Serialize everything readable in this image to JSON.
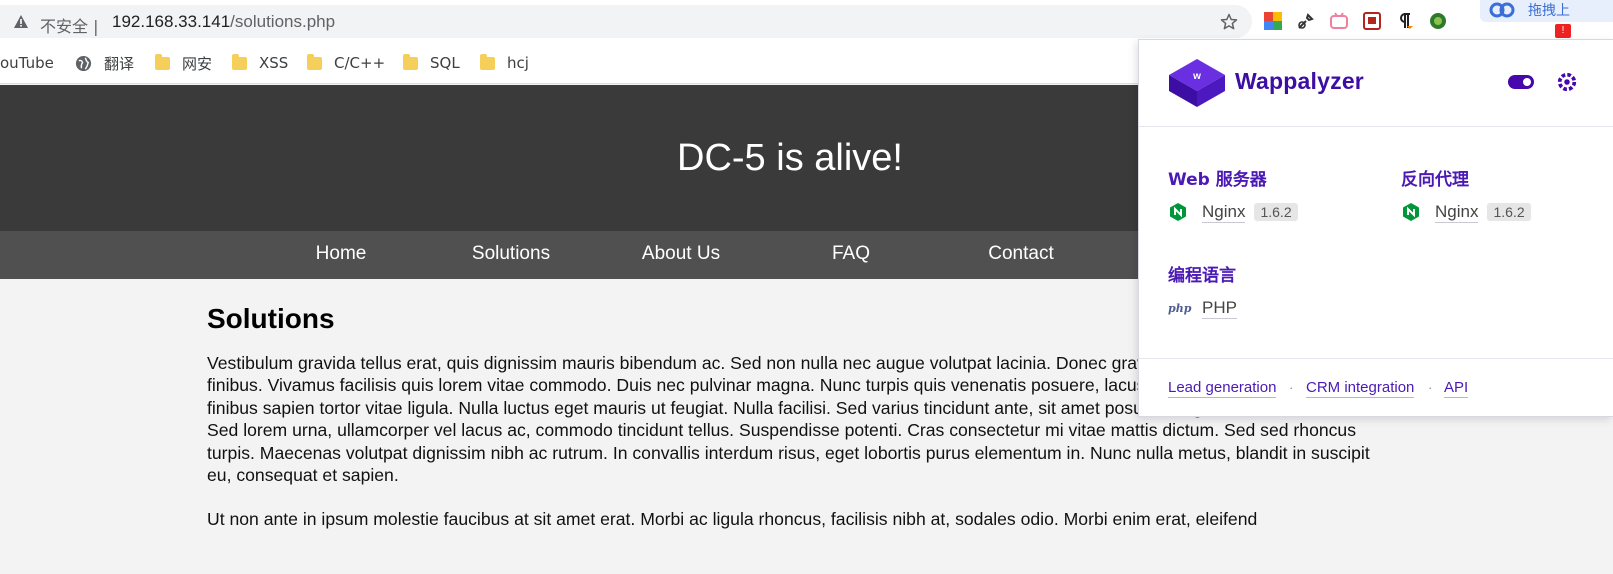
{
  "browser": {
    "insecure_label": "不安全",
    "separator": "|",
    "url_host": "192.168.33.141",
    "url_path": "/solutions.php",
    "baidu_text": "拖拽上",
    "baidu_badge": "!"
  },
  "bookmarks": [
    {
      "label": "ouTube",
      "icon": "none"
    },
    {
      "label": "翻译",
      "icon": "globe-icon"
    },
    {
      "label": "网安",
      "icon": "folder-icon"
    },
    {
      "label": "XSS",
      "icon": "folder-icon"
    },
    {
      "label": "C/C++",
      "icon": "folder-icon"
    },
    {
      "label": "SQL",
      "icon": "folder-icon"
    },
    {
      "label": "hcj",
      "icon": "folder-icon"
    }
  ],
  "site": {
    "title": "DC-5 is alive!",
    "nav": [
      "Home",
      "Solutions",
      "About Us",
      "FAQ",
      "Contact"
    ],
    "heading": "Solutions",
    "paragraph1": "Vestibulum gravida tellus erat, quis dignissim mauris bibendum ac. Sed non nulla nec augue volutpat lacinia. Donec gravida diam tempus odio ultrices finibus. Vivamus facilisis quis lorem vitae commodo. Duis nec pulvinar magna. Nunc turpis quis venenatis posuere, lacus ante elementum purus, id finibus sapien tortor vitae ligula. Nulla luctus eget mauris ut feugiat. Nulla facilisi. Sed varius tincidunt ante, sit amet posuere augue venenatis sit amet. Sed lorem urna, ullamcorper vel lacus ac, commodo tincidunt tellus. Suspendisse potenti. Cras consectetur mi vitae mattis dictum. Sed sed rhoncus turpis. Maecenas volutpat dignissim nibh ac rutrum. In convallis interdum risus, eget lobortis purus elementum in. Nunc nulla metus, blandit in suscipit eu, consequat et sapien.",
    "paragraph2": "Ut non ante in ipsum molestie faucibus at sit amet erat. Morbi ac ligula rhoncus, facilisis nibh at, sodales odio. Morbi enim erat, eleifend"
  },
  "wappalyzer": {
    "name": "Wappalyzer",
    "categories": [
      {
        "title": "Web 服务器",
        "tech": "Nginx",
        "version": "1.6.2"
      },
      {
        "title": "反向代理",
        "tech": "Nginx",
        "version": "1.6.2"
      },
      {
        "title": "编程语言",
        "tech": "PHP",
        "version": ""
      }
    ],
    "php_icon_text": "php",
    "footer": [
      "Lead generation",
      "CRM integration",
      "API"
    ],
    "footer_sep": "·",
    "colors": {
      "brand": "#4608ad",
      "nginx": "#009639"
    }
  },
  "colors": {
    "header_bg": "#3a3a3a",
    "nav_bg": "#505050",
    "page_bg": "#f3f3f3"
  }
}
